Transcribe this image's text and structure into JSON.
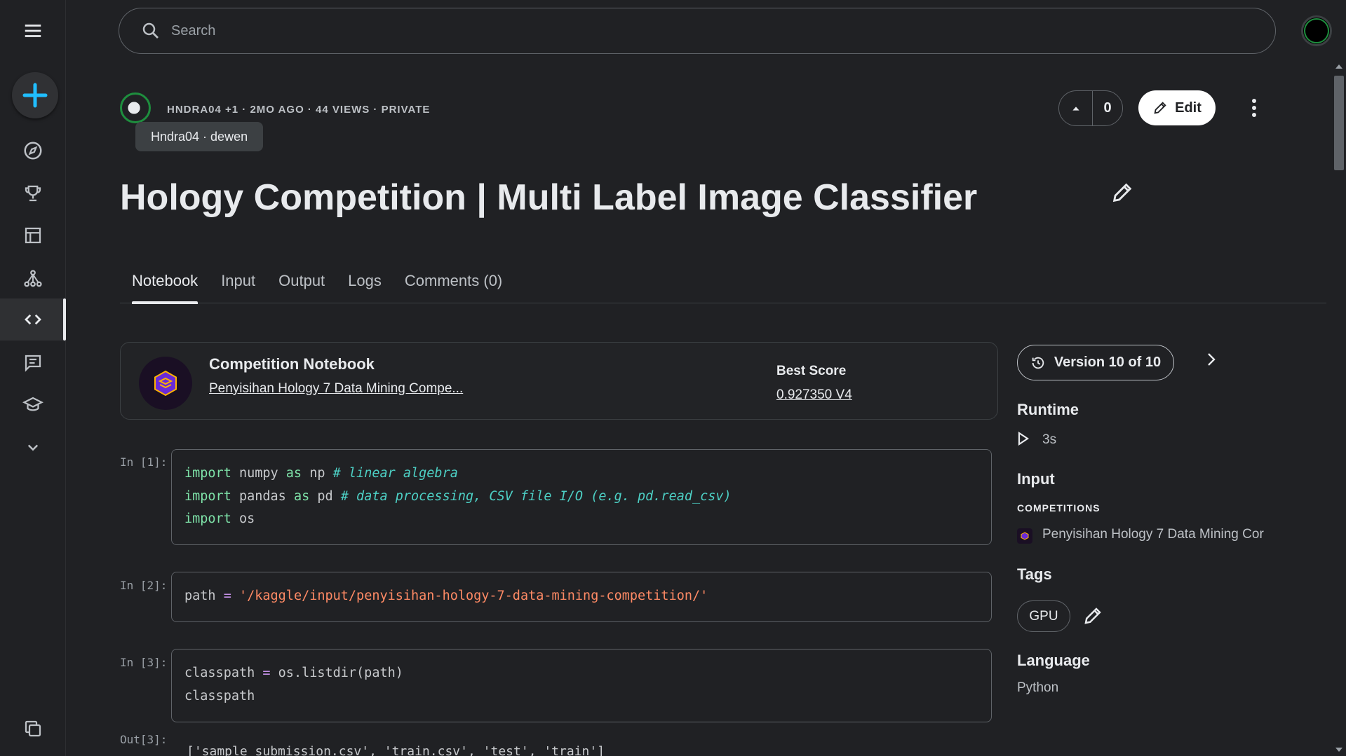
{
  "search": {
    "placeholder": "Search"
  },
  "rail": {
    "items": [
      {
        "name": "menu-icon"
      },
      {
        "name": "create-icon"
      },
      {
        "name": "explore-icon"
      },
      {
        "name": "competitions-icon"
      },
      {
        "name": "datasets-icon"
      },
      {
        "name": "models-icon"
      },
      {
        "name": "code-icon"
      },
      {
        "name": "discussions-icon"
      },
      {
        "name": "learn-icon"
      },
      {
        "name": "more-icon"
      },
      {
        "name": "your-work-icon"
      }
    ]
  },
  "header": {
    "meta": "HNDRA04 +1 · 2MO AGO · 44 VIEWS · PRIVATE",
    "tooltip": "Hndra04 · dewen",
    "vote_count": "0",
    "edit_label": "Edit",
    "title": "Hology Competition | Multi Label Image Classifier"
  },
  "tabs": [
    {
      "label": "Notebook",
      "active": true
    },
    {
      "label": "Input"
    },
    {
      "label": "Output"
    },
    {
      "label": "Logs"
    },
    {
      "label": "Comments (0)"
    }
  ],
  "competition": {
    "type_label": "Competition Notebook",
    "name": "Penyisihan Hology 7 Data Mining Compe...",
    "best_score_label": "Best Score",
    "best_score_value": "0.927350 V4"
  },
  "cells": [
    {
      "prompt": "In [1]:"
    },
    {
      "prompt": "In [2]:"
    },
    {
      "prompt": "In [3]:"
    }
  ],
  "output": {
    "prompt": "Out[3]:",
    "text": "['sample_submission.csv', 'train.csv', 'test', 'train']"
  },
  "sidebar": {
    "version_label": "Version 10 of 10",
    "runtime_heading": "Runtime",
    "runtime_value": "3s",
    "input_heading": "Input",
    "competitions_label": "COMPETITIONS",
    "competition_name": "Penyisihan Hology 7 Data Mining Cor",
    "tags_heading": "Tags",
    "tag": "GPU",
    "language_heading": "Language",
    "language_value": "Python"
  },
  "colors": {
    "background": "#202124",
    "accent_blue": "#20beff",
    "keyword": "#7ee2a8",
    "comment": "#4dd0c5",
    "string": "#ff8a65",
    "operator": "#c792ea"
  }
}
